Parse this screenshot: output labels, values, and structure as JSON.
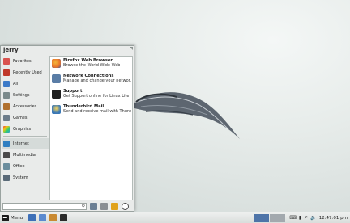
{
  "user": {
    "name": "jerry"
  },
  "categories": [
    {
      "label": "Favorites",
      "icon": "star-icon",
      "color": "#d9534f"
    },
    {
      "label": "Recently Used",
      "icon": "clock-icon",
      "color": "#c0392b"
    },
    {
      "label": "All",
      "icon": "grid-icon",
      "color": "#3d7bc8"
    },
    {
      "label": "Settings",
      "icon": "settings-icon",
      "color": "#7b8a8b"
    },
    {
      "label": "Accessories",
      "icon": "accessories-icon",
      "color": "#b0712f"
    },
    {
      "label": "Games",
      "icon": "games-icon",
      "color": "#6b7c8a"
    },
    {
      "label": "Graphics",
      "icon": "graphics-icon",
      "color": "#c94fbf"
    },
    {
      "label": "Internet",
      "icon": "internet-icon",
      "color": "#2f7fc1"
    },
    {
      "label": "Multimedia",
      "icon": "multimedia-icon",
      "color": "#4a4a4a"
    },
    {
      "label": "Office",
      "icon": "office-icon",
      "color": "#6b8e9e"
    },
    {
      "label": "System",
      "icon": "system-icon",
      "color": "#5a6a78"
    }
  ],
  "apps": [
    {
      "name": "Firefox Web Browser",
      "desc": "Browse the World Wide Web",
      "icon": "firefox-icon",
      "color": "#e8732a"
    },
    {
      "name": "Network Connections",
      "desc": "Manage and change your networ…",
      "icon": "network-icon",
      "color": "#5a7da6"
    },
    {
      "name": "Support",
      "desc": "Get Support online for Linux Lite",
      "icon": "support-icon",
      "color": "#1f1f1f"
    },
    {
      "name": "Thunderbird Mail",
      "desc": "Send and receive mail with Thund…",
      "icon": "thunderbird-icon",
      "color": "#3a78b6"
    }
  ],
  "search": {
    "placeholder": "",
    "value": ""
  },
  "footer_buttons": [
    {
      "icon": "display-settings-icon",
      "color": "#6b7f94"
    },
    {
      "icon": "user-settings-icon",
      "color": "#8a8f93"
    },
    {
      "icon": "logout-icon",
      "color": "#e0a21b"
    },
    {
      "icon": "power-icon",
      "color": "#4a4a4a"
    }
  ],
  "taskbar": {
    "menu_label": "Menu",
    "launchers": [
      {
        "icon": "firefox-icon",
        "color": "#3d70b8"
      },
      {
        "icon": "files-icon",
        "color": "#5a8ad0"
      },
      {
        "icon": "editor-icon",
        "color": "#c98a32"
      },
      {
        "icon": "terminal-icon",
        "color": "#2b2b2b"
      }
    ],
    "workspaces": [
      {
        "color": "#4e74a8"
      },
      {
        "color": "#a3a9ae"
      }
    ],
    "tray_icons": [
      "keyboard-icon",
      "battery-icon",
      "network-icon",
      "volume-icon"
    ],
    "clock": "12:47:01 pm"
  }
}
